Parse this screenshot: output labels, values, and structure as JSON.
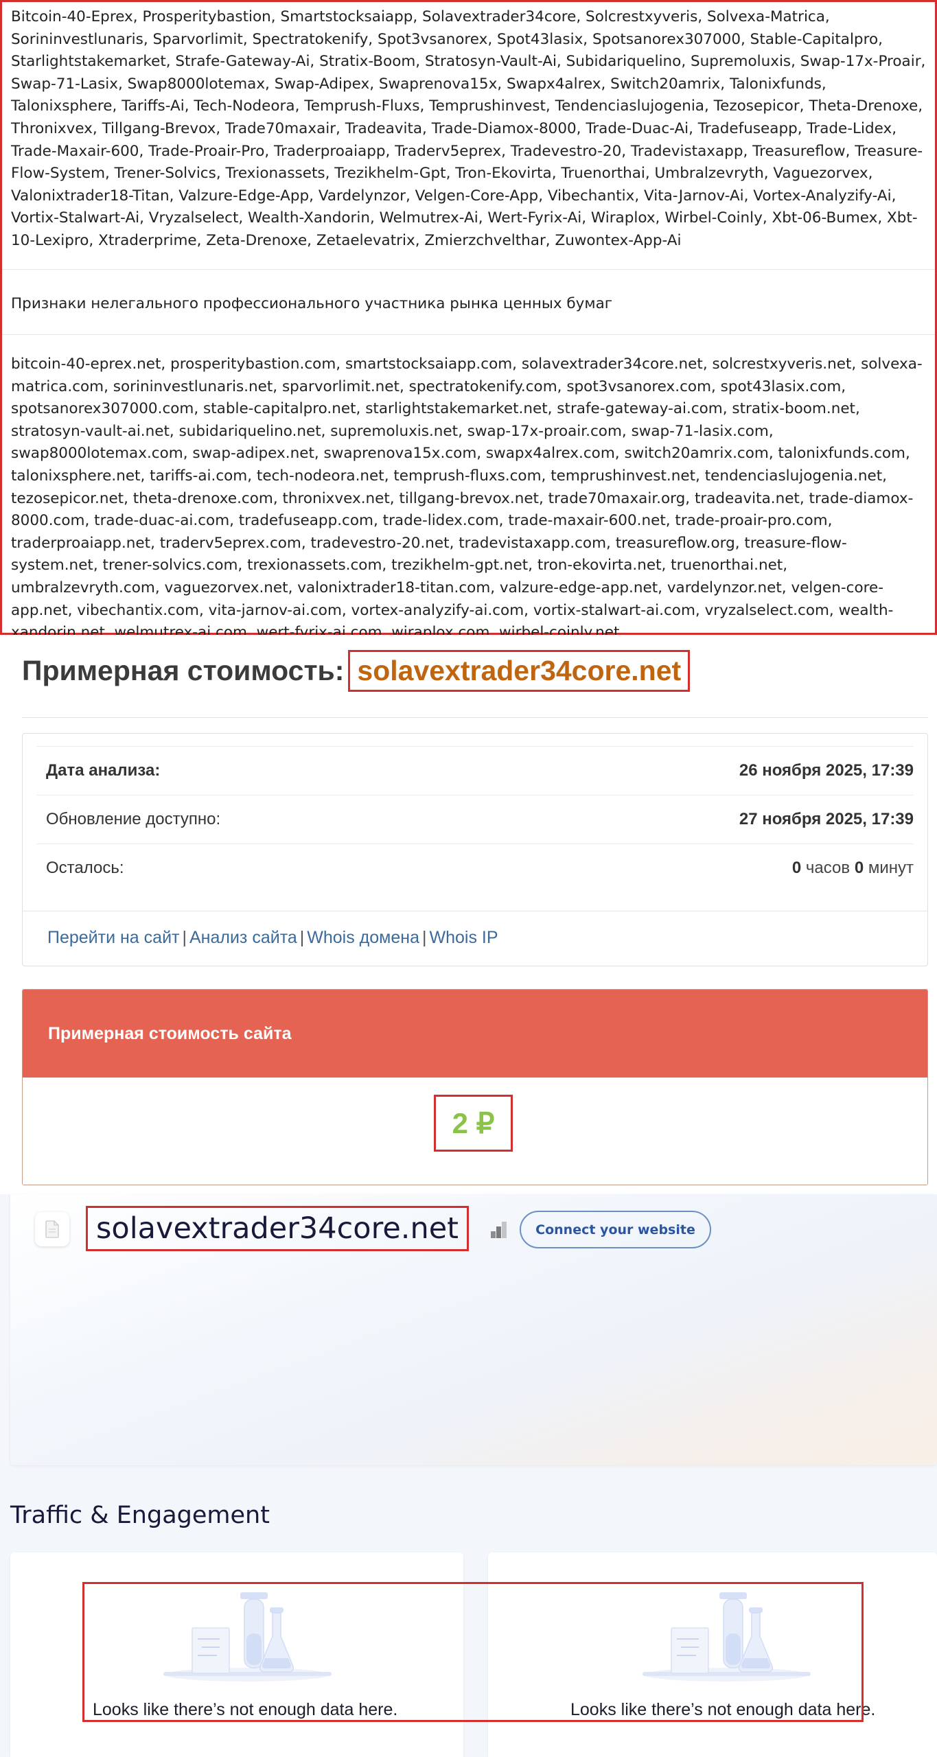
{
  "registry": {
    "names_text": "Bitcoin-40-Eprex, Prosperitybastion, Smartstocksaiapp, Solavextrader34core, Solcrestxyveris, Solvexa-Matrica, Sorininvestlunaris, Sparvorlimit, Spectratokenify, Spot3vsanorex, Spot43lasix, Spotsanorex307000, Stable-Capitalpro, Starlightstakemarket, Strafe-Gateway-Ai, Stratix-Boom, Stratosyn-Vault-Ai, Subidariquelino, Supremoluxis, Swap-17x-Proair, Swap-71-Lasix, Swap8000lotemax, Swap-Adipex, Swaprenova15x, Swapx4alrex, Switch20amrix, Talonixfunds, Talonixsphere, Tariffs-Ai, Tech-Nodeora, Temprush-Fluxs, Temprushinvest, Tendenciaslujogenia, Tezosepicor, Theta-Drenoxe, Thronixvex, Tillgang-Brevox, Trade70maxair, Tradeavita, Trade-Diamox-8000, Trade-Duac-Ai, Tradefuseapp, Trade-Lidex, Trade-Maxair-600, Trade-Proair-Pro, Traderproaiapp, Traderv5eprex, Tradevestro-20, Tradevistaxapp, Treasureflow, Treasure-Flow-System, Trener-Solvics, Trexionassets, Trezikhelm-Gpt, Tron-Ekovirta, Truenorthai, Umbralzevryth, Vaguezorvex, Valonixtrader18-Titan, Valzure-Edge-App, Vardelynzor, Velgen-Core-App, Vibechantix, Vita-Jarnov-Ai, Vortex-Analyzify-Ai, Vortix-Stalwart-Ai, Vryzalselect, Wealth-Xandorin, Welmutrex-Ai, Wert-Fyrix-Ai, Wiraplox, Wirbel-Coinly, Xbt-06-Bumex, Xbt-10-Lexipro, Xtraderprime, Zeta-Drenoxe, Zetaelevatrix, Zmierzchvelthar, Zuwontex-App-Ai",
    "sign_label": "Признаки нелегального профессионального участника рынка ценных бумаг",
    "domains_text": "bitcoin-40-eprex.net, prosperitybastion.com, smartstocksaiapp.com, solavextrader34core.net, solcrestxyveris.net, solvexa-matrica.com, sorininvestlunaris.net, sparvorlimit.net, spectratokenify.com, spot3vsanorex.com, spot43lasix.com, spotsanorex307000.com, stable-capitalpro.net, starlightstakemarket.net, strafe-gateway-ai.com, stratix-boom.net, stratosyn-vault-ai.net, subidariquelino.net, supremoluxis.net, swap-17x-proair.com, swap-71-lasix.com, swap8000lotemax.com, swap-adipex.net, swaprenova15x.com, swapx4alrex.com, switch20amrix.com, talonixfunds.com, talonixsphere.net, tariffs-ai.com, tech-nodeora.net, temprush-fluxs.com, temprushinvest.net, tendenciaslujogenia.net, tezosepicor.net, theta-drenoxe.com, thronixvex.net, tillgang-brevox.net, trade70maxair.org, tradeavita.net, trade-diamox-8000.com, trade-duac-ai.com, tradefuseapp.com, trade-lidex.com, trade-maxair-600.net, trade-proair-pro.com, traderproaiapp.net, traderv5eprex.com, tradevestro-20.net, tradevistaxapp.com, treasureflow.org, treasure-flow-system.net, trener-solvics.com, trexionassets.com, trezikhelm-gpt.net, tron-ekovirta.net, truenorthai.net, umbralzevryth.com, vaguezorvex.net, valonixtrader18-titan.com, valzure-edge-app.net, vardelynzor.net, velgen-core-app.net, vibechantix.com, vita-jarnov-ai.com, vortex-analyzify-ai.com, vortix-stalwart-ai.com, vryzalselect.com, wealth-xandorin.net, welmutrex-ai.com, wert-fyrix-ai.com, wiraplox.com, wirbel-coinly.net,"
  },
  "cost": {
    "title_prefix": "Примерная стоимость:",
    "domain": "solavextrader34core.net",
    "rows": [
      {
        "label": "Дата анализа:",
        "value": "26 ноября 2025, 17:39"
      },
      {
        "label": "Обновление доступно:",
        "value": "27 ноября 2025, 17:39"
      },
      {
        "label": "Осталось:",
        "hours": "0",
        "hours_unit": "часов",
        "minutes": "0",
        "minutes_unit": "минут"
      }
    ],
    "links": [
      "Перейти на сайт",
      "Анализ сайта",
      "Whois домена",
      "Whois IP"
    ],
    "link_separator": "|",
    "estimate_header": "Примерная стоимость сайта",
    "estimate_value": "2 ₽",
    "colors": {
      "accent_red": "#e56353",
      "price_green": "#8bc34a",
      "domain_orange": "#c0650f"
    }
  },
  "semrush": {
    "domain": "solavextrader34core.net",
    "favicon_icon": "document-icon",
    "bars_icon": "signal-bars-icon",
    "connect_label": "Connect your website",
    "section_title": "Traffic & Engagement",
    "empty_messages": [
      "Looks like there’s not enough data here.",
      "Looks like there’s not enough data here."
    ],
    "empty_icon": "lab-flasks-illustration-icon"
  },
  "highlight_color": "#d32f2f"
}
